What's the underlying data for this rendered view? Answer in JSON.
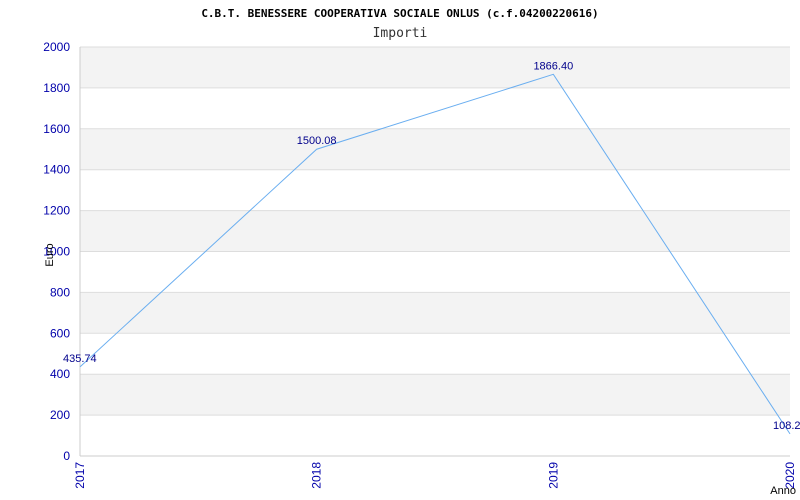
{
  "chart_data": {
    "type": "line",
    "title": "C.B.T. BENESSERE COOPERATIVA SOCIALE ONLUS (c.f.04200220616)",
    "subtitle": "Importi",
    "xlabel": "Anno",
    "ylabel": "Euro",
    "categories": [
      "2017",
      "2018",
      "2019",
      "2020"
    ],
    "values": [
      435.74,
      1500.08,
      1866.4,
      108.2
    ],
    "value_labels": [
      "435.74",
      "1500.08",
      "1866.40",
      "108.2"
    ],
    "ylim": [
      0,
      2000
    ],
    "yticks": [
      0,
      200,
      400,
      600,
      800,
      1000,
      1200,
      1400,
      1600,
      1800,
      2000
    ],
    "grid": true,
    "legend": "none",
    "colors": {
      "line": "#6aaef0",
      "band": "#f3f3f3",
      "grid": "#dddddd",
      "tick_text": "#0000aa",
      "label_text": "#00008b"
    }
  }
}
